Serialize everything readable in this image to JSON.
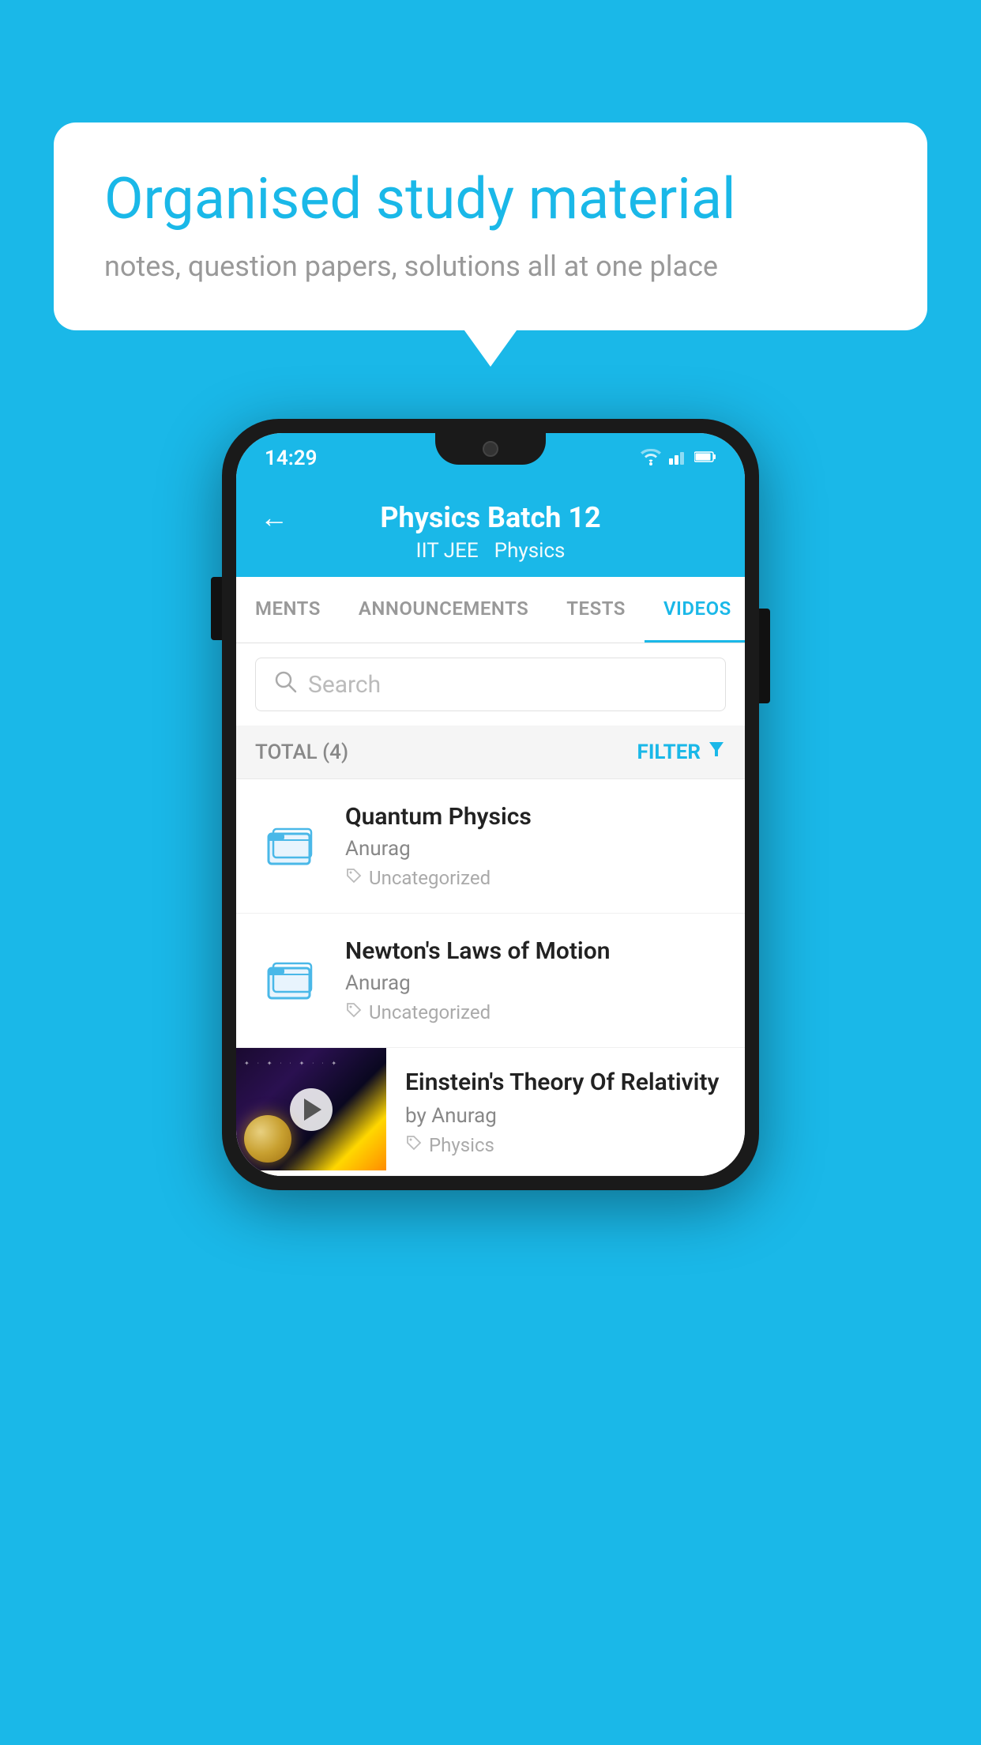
{
  "background": {
    "color": "#1ab8e8"
  },
  "speech_bubble": {
    "title": "Organised study material",
    "subtitle": "notes, question papers, solutions all at one place"
  },
  "status_bar": {
    "time": "14:29",
    "wifi": "▾",
    "signal": "▴▴",
    "battery": "▮"
  },
  "app_header": {
    "back_label": "←",
    "title": "Physics Batch 12",
    "tag1": "IIT JEE",
    "tag2": "Physics"
  },
  "tabs": [
    {
      "label": "MENTS",
      "active": false
    },
    {
      "label": "ANNOUNCEMENTS",
      "active": false
    },
    {
      "label": "TESTS",
      "active": false
    },
    {
      "label": "VIDEOS",
      "active": true
    }
  ],
  "search": {
    "placeholder": "Search"
  },
  "filter_bar": {
    "total_label": "TOTAL (4)",
    "filter_label": "FILTER"
  },
  "videos": [
    {
      "title": "Quantum Physics",
      "author": "Anurag",
      "tag": "Uncategorized",
      "has_thumb": false
    },
    {
      "title": "Newton's Laws of Motion",
      "author": "Anurag",
      "tag": "Uncategorized",
      "has_thumb": false
    },
    {
      "title": "Einstein's Theory Of Relativity",
      "author": "by Anurag",
      "tag": "Physics",
      "has_thumb": true
    }
  ]
}
